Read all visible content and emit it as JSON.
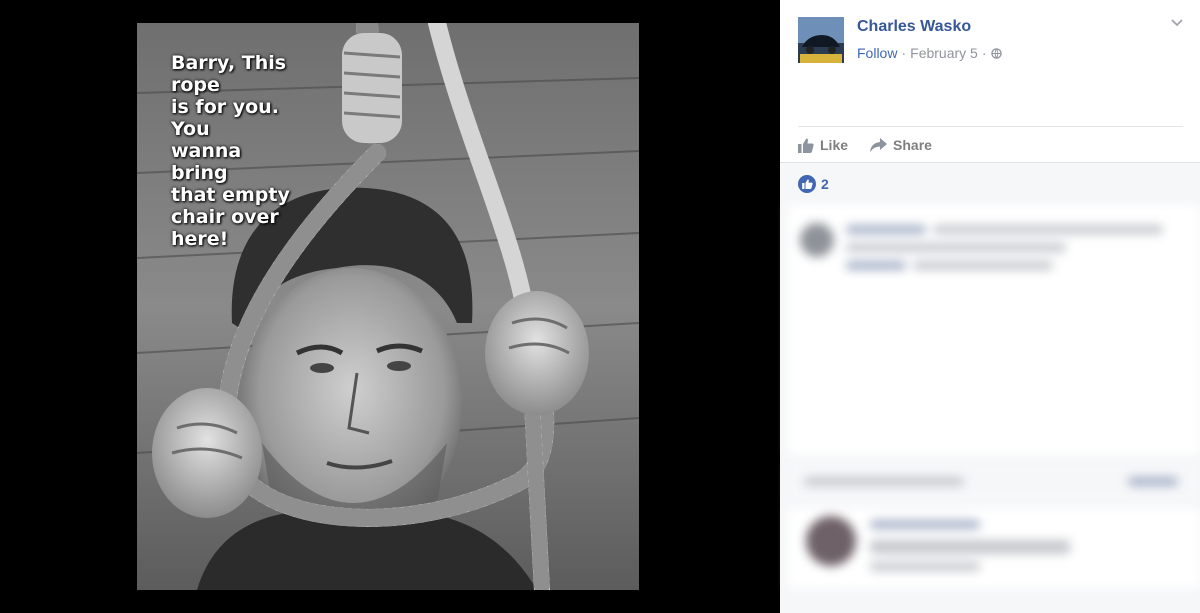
{
  "photo": {
    "caption": "Barry, This\nrope\nis for you.\nYou\nwanna\nbring\nthat empty\nchair over\nhere!"
  },
  "post": {
    "author": "Charles Wasko",
    "follow_label": "Follow",
    "separator": "·",
    "date": "February 5",
    "avatar_icon": "car-photo-avatar",
    "privacy_icon": "globe-icon",
    "menu_icon": "chevron-down-icon"
  },
  "actions": {
    "like_label": "Like",
    "share_label": "Share"
  },
  "reactions": {
    "count": "2",
    "icon": "thumbs-up-icon"
  },
  "colors": {
    "link": "#365899",
    "accent": "#4267b2",
    "muted": "#90949c",
    "panel_bg": "#f6f7f9"
  }
}
